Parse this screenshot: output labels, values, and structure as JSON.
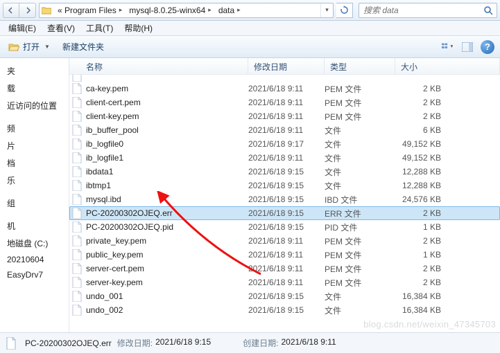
{
  "address": {
    "crumbs": [
      "« Program Files",
      "mysql-8.0.25-winx64",
      "data"
    ]
  },
  "search": {
    "placeholder": "搜索 data"
  },
  "menu": {
    "edit": "编辑(E)",
    "view": "查看(V)",
    "tools": "工具(T)",
    "help": "帮助(H)"
  },
  "toolbar": {
    "open": "打开",
    "newfolder": "新建文件夹"
  },
  "columns": {
    "name": "名称",
    "date": "修改日期",
    "type": "类型",
    "size": "大小"
  },
  "sidebar": {
    "items": [
      "夹",
      "载",
      "近访问的位置",
      "",
      "频",
      "片",
      "档",
      "乐",
      "",
      "组",
      "",
      "机",
      "地磁盘 (C:)",
      "20210604",
      "EasyDrv7"
    ]
  },
  "files": [
    {
      "name": "ca-key.pem",
      "date": "2021/6/18 9:11",
      "type": "PEM 文件",
      "size": "2 KB"
    },
    {
      "name": "client-cert.pem",
      "date": "2021/6/18 9:11",
      "type": "PEM 文件",
      "size": "2 KB"
    },
    {
      "name": "client-key.pem",
      "date": "2021/6/18 9:11",
      "type": "PEM 文件",
      "size": "2 KB"
    },
    {
      "name": "ib_buffer_pool",
      "date": "2021/6/18 9:11",
      "type": "文件",
      "size": "6 KB"
    },
    {
      "name": "ib_logfile0",
      "date": "2021/6/18 9:17",
      "type": "文件",
      "size": "49,152 KB"
    },
    {
      "name": "ib_logfile1",
      "date": "2021/6/18 9:11",
      "type": "文件",
      "size": "49,152 KB"
    },
    {
      "name": "ibdata1",
      "date": "2021/6/18 9:15",
      "type": "文件",
      "size": "12,288 KB"
    },
    {
      "name": "ibtmp1",
      "date": "2021/6/18 9:15",
      "type": "文件",
      "size": "12,288 KB"
    },
    {
      "name": "mysql.ibd",
      "date": "2021/6/18 9:15",
      "type": "IBD 文件",
      "size": "24,576 KB"
    },
    {
      "name": "PC-20200302OJEQ.err",
      "date": "2021/6/18 9:15",
      "type": "ERR 文件",
      "size": "2 KB",
      "selected": true
    },
    {
      "name": "PC-20200302OJEQ.pid",
      "date": "2021/6/18 9:15",
      "type": "PID 文件",
      "size": "1 KB"
    },
    {
      "name": "private_key.pem",
      "date": "2021/6/18 9:11",
      "type": "PEM 文件",
      "size": "2 KB"
    },
    {
      "name": "public_key.pem",
      "date": "2021/6/18 9:11",
      "type": "PEM 文件",
      "size": "1 KB"
    },
    {
      "name": "server-cert.pem",
      "date": "2021/6/18 9:11",
      "type": "PEM 文件",
      "size": "2 KB"
    },
    {
      "name": "server-key.pem",
      "date": "2021/6/18 9:11",
      "type": "PEM 文件",
      "size": "2 KB"
    },
    {
      "name": "undo_001",
      "date": "2021/6/18 9:15",
      "type": "文件",
      "size": "16,384 KB"
    },
    {
      "name": "undo_002",
      "date": "2021/6/18 9:15",
      "type": "文件",
      "size": "16,384 KB"
    }
  ],
  "cutrow": {
    "name": "",
    "date": "",
    "type": "",
    "size": ""
  },
  "status": {
    "filename": "PC-20200302OJEQ.err",
    "mod_label": "修改日期:",
    "mod_value": "2021/6/18 9:15",
    "create_label": "创建日期:",
    "create_value": "2021/6/18 9:11"
  },
  "watermark": "blog.csdn.net/weixin_47345703"
}
